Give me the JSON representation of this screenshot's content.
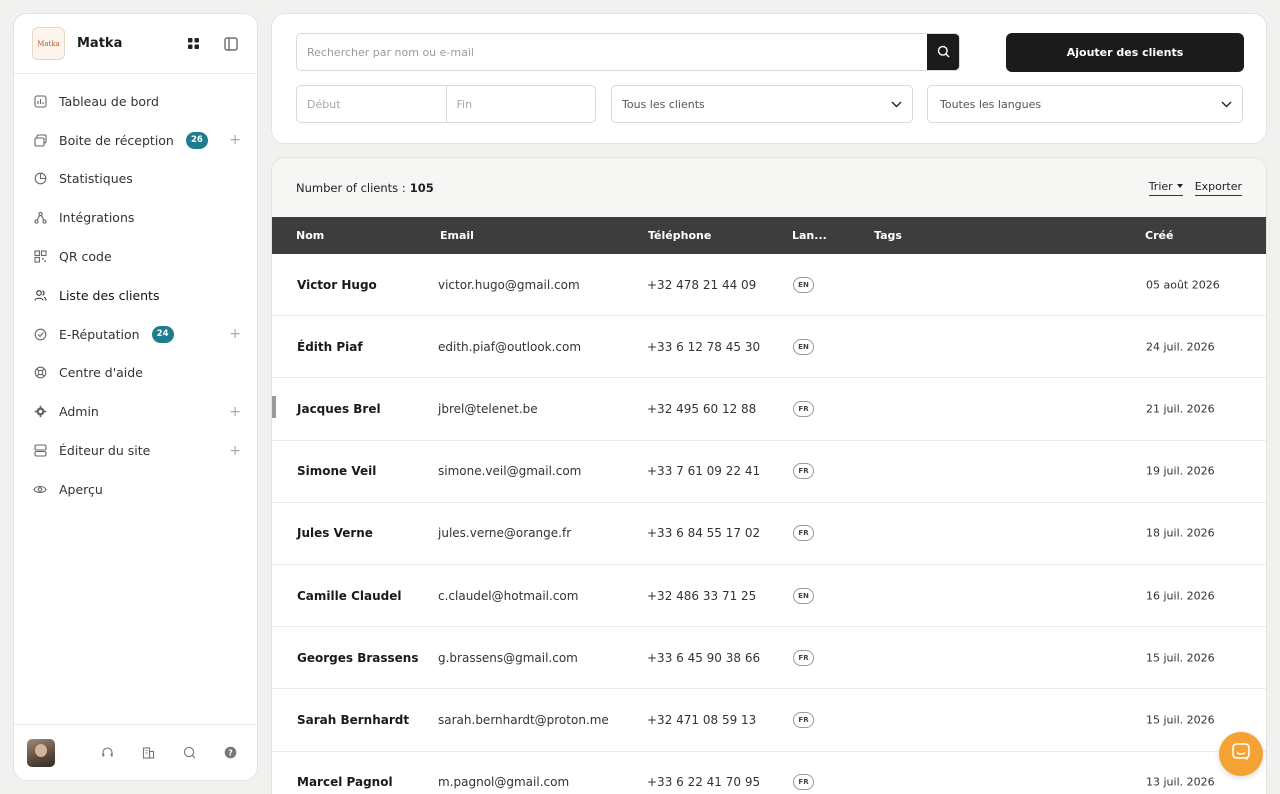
{
  "brand": {
    "name": "Matka",
    "logo_text": "Matka"
  },
  "sidebar": {
    "items": [
      {
        "label": "Tableau de bord",
        "icon": "chart-icon"
      },
      {
        "label": "Boite de réception",
        "icon": "inbox-icon",
        "badge": "26",
        "plus": "+"
      },
      {
        "label": "Statistiques",
        "icon": "pie-chart-icon"
      },
      {
        "label": "Intégrations",
        "icon": "integrations-icon"
      },
      {
        "label": "QR code",
        "icon": "qr-code-icon"
      },
      {
        "label": "Liste des clients",
        "icon": "users-icon",
        "active": true
      },
      {
        "label": "E-Réputation",
        "icon": "reputation-icon",
        "badge": "24",
        "plus": "+"
      },
      {
        "label": "Centre d'aide",
        "icon": "help-ring-icon"
      },
      {
        "label": "Admin",
        "icon": "gear-icon",
        "plus": "+"
      },
      {
        "label": "Éditeur du site",
        "icon": "layout-icon",
        "plus": "+"
      },
      {
        "label": "Aperçu",
        "icon": "eye-icon"
      }
    ]
  },
  "filters": {
    "search_placeholder": "Rechercher par nom ou e-mail",
    "add_button": "Ajouter des clients",
    "start_placeholder": "Début",
    "end_placeholder": "Fin",
    "clients_select": "Tous les clients",
    "languages_select": "Toutes les langues"
  },
  "list": {
    "count_label": "Number of clients :",
    "count": "105",
    "sort_label": "Trier",
    "export_label": "Exporter",
    "columns": {
      "name": "Nom",
      "email": "Email",
      "phone": "Téléphone",
      "lang": "Lan...",
      "tags": "Tags",
      "created": "Créé"
    },
    "rows": [
      {
        "name": "Victor Hugo",
        "email": "victor.hugo@gmail.com",
        "phone": "+32 478 21 44 09",
        "lang": "EN",
        "created": "05 août 2026"
      },
      {
        "name": "Édith Piaf",
        "email": "edith.piaf@outlook.com",
        "phone": "+33 6 12 78 45 30",
        "lang": "EN",
        "created": "24 juil. 2026"
      },
      {
        "name": "Jacques Brel",
        "email": "jbrel@telenet.be",
        "phone": "+32 495 60 12 88",
        "lang": "FR",
        "created": "21 juil. 2026"
      },
      {
        "name": "Simone Veil",
        "email": "simone.veil@gmail.com",
        "phone": "+33 7 61 09 22 41",
        "lang": "FR",
        "created": "19 juil. 2026"
      },
      {
        "name": "Jules Verne",
        "email": "jules.verne@orange.fr",
        "phone": "+33 6 84 55 17 02",
        "lang": "FR",
        "created": "18 juil. 2026"
      },
      {
        "name": "Camille Claudel",
        "email": "c.claudel@hotmail.com",
        "phone": "+32 486 33 71 25",
        "lang": "EN",
        "created": "16 juil. 2026"
      },
      {
        "name": "Georges Brassens",
        "email": "g.brassens@gmail.com",
        "phone": "+33 6 45 90 38 66",
        "lang": "FR",
        "created": "15 juil. 2026"
      },
      {
        "name": "Sarah Bernhardt",
        "email": "sarah.bernhardt@proton.me",
        "phone": "+32 471 08 59 13",
        "lang": "FR",
        "created": "15 juil. 2026"
      },
      {
        "name": "Marcel Pagnol",
        "email": "m.pagnol@gmail.com",
        "phone": "+33 6 22 41 70 95",
        "lang": "FR",
        "created": "13 juil. 2026"
      }
    ]
  },
  "footer_icons": [
    "headset-icon",
    "building-icon",
    "chat-search-icon",
    "help-icon"
  ],
  "chat_icon": "chat-bubble-icon",
  "colors": {
    "badge": "#1e7d8c",
    "primary": "#1b1b1b",
    "table_header": "#3d3d3d",
    "chat": "#f5a235"
  }
}
